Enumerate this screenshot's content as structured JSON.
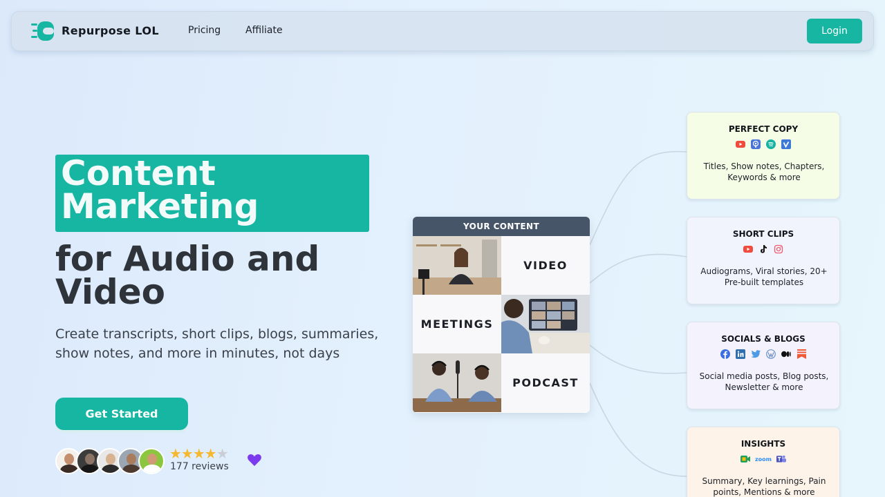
{
  "nav": {
    "brand": "Repurpose LOL",
    "links": [
      "Pricing",
      "Affiliate"
    ],
    "login_label": "Login"
  },
  "hero": {
    "highlight": "Content Marketing",
    "headline": "for Audio and Video",
    "subtitle": "Create transcripts, short clips, blogs, summaries, show notes, and more in minutes, not days",
    "cta_label": "Get Started",
    "rating_stars": 4.5,
    "reviews": "177 reviews"
  },
  "content_panel": {
    "title": "YOUR CONTENT",
    "labels": {
      "video": "VIDEO",
      "meetings": "MEETINGS",
      "podcast": "PODCAST"
    }
  },
  "cards": [
    {
      "title": "PERFECT COPY",
      "icons": [
        "youtube-icon",
        "apple-podcasts-icon",
        "spotify-icon",
        "vimeo-icon"
      ],
      "desc": "Titles, Show notes, Chapters, Keywords & more"
    },
    {
      "title": "SHORT CLIPS",
      "icons": [
        "youtube-icon",
        "tiktok-icon",
        "instagram-icon"
      ],
      "desc": "Audiograms, Viral stories, 20+ Pre-built templates"
    },
    {
      "title": "SOCIALS & BLOGS",
      "icons": [
        "facebook-icon",
        "linkedin-icon",
        "twitter-icon",
        "wordpress-icon",
        "medium-icon",
        "substack-icon"
      ],
      "desc": "Social media posts, Blog posts, Newsletter & more"
    },
    {
      "title": "INSIGHTS",
      "icons": [
        "google-meet-icon",
        "zoom-icon",
        "teams-icon"
      ],
      "desc": "Summary, Key learnings, Pain points, Mentions & more",
      "zoom_text": "zoom"
    }
  ],
  "colors": {
    "accent": "#17b6a3",
    "panel_header": "#475569",
    "star": "#f5b82e",
    "heart": "#7c3aed"
  }
}
